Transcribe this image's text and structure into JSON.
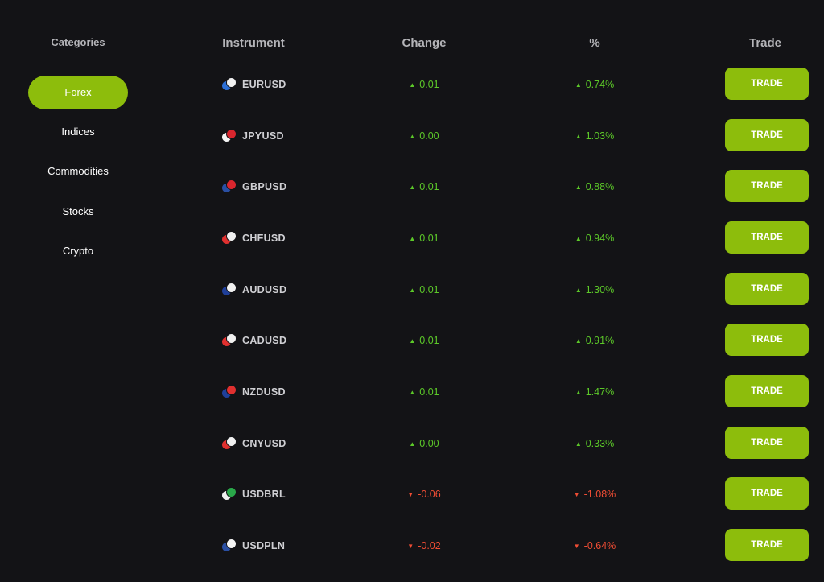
{
  "sidebar": {
    "title": "Categories",
    "items": [
      {
        "label": "Forex",
        "active": true
      },
      {
        "label": "Indices",
        "active": false
      },
      {
        "label": "Commodities",
        "active": false
      },
      {
        "label": "Stocks",
        "active": false
      },
      {
        "label": "Crypto",
        "active": false
      }
    ]
  },
  "table": {
    "headers": {
      "instrument": "Instrument",
      "change": "Change",
      "percent": "%",
      "trade": "Trade"
    },
    "rows": [
      {
        "instrument": "EURUSD",
        "change": "0.01",
        "percent": "0.74%",
        "direction": "up",
        "trade_label": "TRADE",
        "flag_colors": [
          "#2c6fd6",
          "#f0f0f0"
        ]
      },
      {
        "instrument": "JPYUSD",
        "change": "0.00",
        "percent": "1.03%",
        "direction": "up",
        "trade_label": "TRADE",
        "flag_colors": [
          "#f5f5f5",
          "#d9262e"
        ]
      },
      {
        "instrument": "GBPUSD",
        "change": "0.01",
        "percent": "0.88%",
        "direction": "up",
        "trade_label": "TRADE",
        "flag_colors": [
          "#2a4fa3",
          "#d9262e"
        ]
      },
      {
        "instrument": "CHFUSD",
        "change": "0.01",
        "percent": "0.94%",
        "direction": "up",
        "trade_label": "TRADE",
        "flag_colors": [
          "#e0302f",
          "#f0f0f0"
        ]
      },
      {
        "instrument": "AUDUSD",
        "change": "0.01",
        "percent": "1.30%",
        "direction": "up",
        "trade_label": "TRADE",
        "flag_colors": [
          "#1f3f9a",
          "#f0f0f0"
        ]
      },
      {
        "instrument": "CADUSD",
        "change": "0.01",
        "percent": "0.91%",
        "direction": "up",
        "trade_label": "TRADE",
        "flag_colors": [
          "#e0302f",
          "#f0f0f0"
        ]
      },
      {
        "instrument": "NZDUSD",
        "change": "0.01",
        "percent": "1.47%",
        "direction": "up",
        "trade_label": "TRADE",
        "flag_colors": [
          "#1f3f9a",
          "#e0302f"
        ]
      },
      {
        "instrument": "CNYUSD",
        "change": "0.00",
        "percent": "0.33%",
        "direction": "up",
        "trade_label": "TRADE",
        "flag_colors": [
          "#e0302f",
          "#f0f0f0"
        ]
      },
      {
        "instrument": "USDBRL",
        "change": "-0.06",
        "percent": "-1.08%",
        "direction": "down",
        "trade_label": "TRADE",
        "flag_colors": [
          "#f0f0f0",
          "#2aa84a"
        ]
      },
      {
        "instrument": "USDPLN",
        "change": "-0.02",
        "percent": "-0.64%",
        "direction": "down",
        "trade_label": "TRADE",
        "flag_colors": [
          "#2a4fa3",
          "#f5f5f5"
        ]
      }
    ]
  },
  "icons": {
    "up": "▲",
    "down": "▼"
  },
  "colors": {
    "accent": "#8dbd0c",
    "up": "#5cc829",
    "down": "#ef4d34",
    "background": "#131316"
  }
}
